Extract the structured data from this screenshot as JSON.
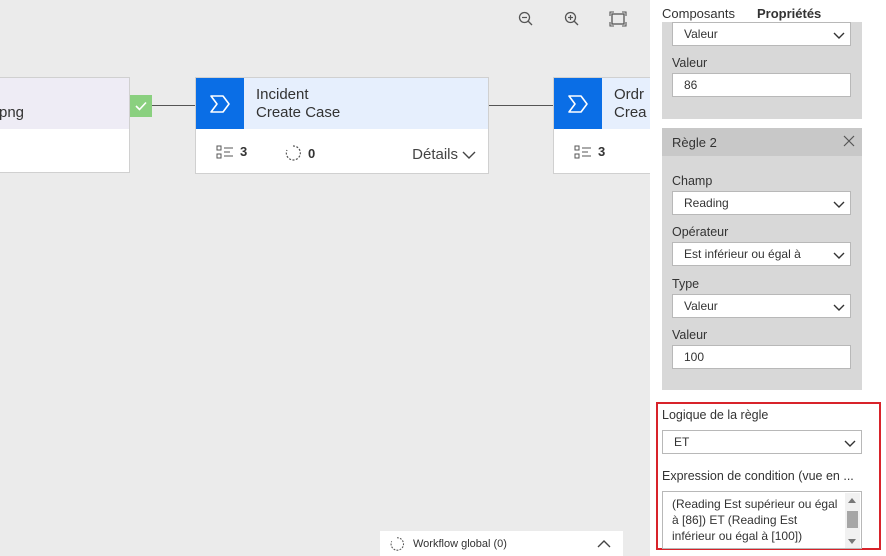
{
  "canvas": {
    "toolbar": {
      "zoom_out": "zoom-out-icon",
      "zoom_in": "zoom-in-icon",
      "fit": "fit-screen-icon"
    },
    "nodes": [
      {
        "id": "left",
        "title": "",
        "subtitle": "png"
      },
      {
        "id": "middle",
        "title": "Incident",
        "subtitle": "Create Case",
        "steps": "3",
        "loops": "0",
        "details": "Détails"
      },
      {
        "id": "right",
        "title": "Ordr",
        "subtitle": "Crea",
        "steps": "3"
      }
    ],
    "global_workflow": "Workflow global (0)"
  },
  "panel": {
    "tabs": [
      "Composants",
      "Propriétés"
    ],
    "rule1": {
      "type_value": "Valeur",
      "value_label": "Valeur",
      "value": "86"
    },
    "rule2": {
      "title": "Règle 2",
      "field_label": "Champ",
      "field_value": "Reading",
      "operator_label": "Opérateur",
      "operator_value": "Est inférieur ou égal à",
      "type_label": "Type",
      "type_value": "Valeur",
      "value_label": "Valeur",
      "value": "100"
    },
    "logic_label": "Logique de la règle",
    "logic_value": "ET",
    "expression_label": "Expression de condition (vue en ...",
    "expression_text": "(Reading Est supérieur ou égal à [86]) ET (Reading Est inférieur ou égal à [100])"
  },
  "colors": {
    "accent": "#0a6ee6",
    "success": "#8ad07f",
    "highlight": "#d8232a"
  }
}
